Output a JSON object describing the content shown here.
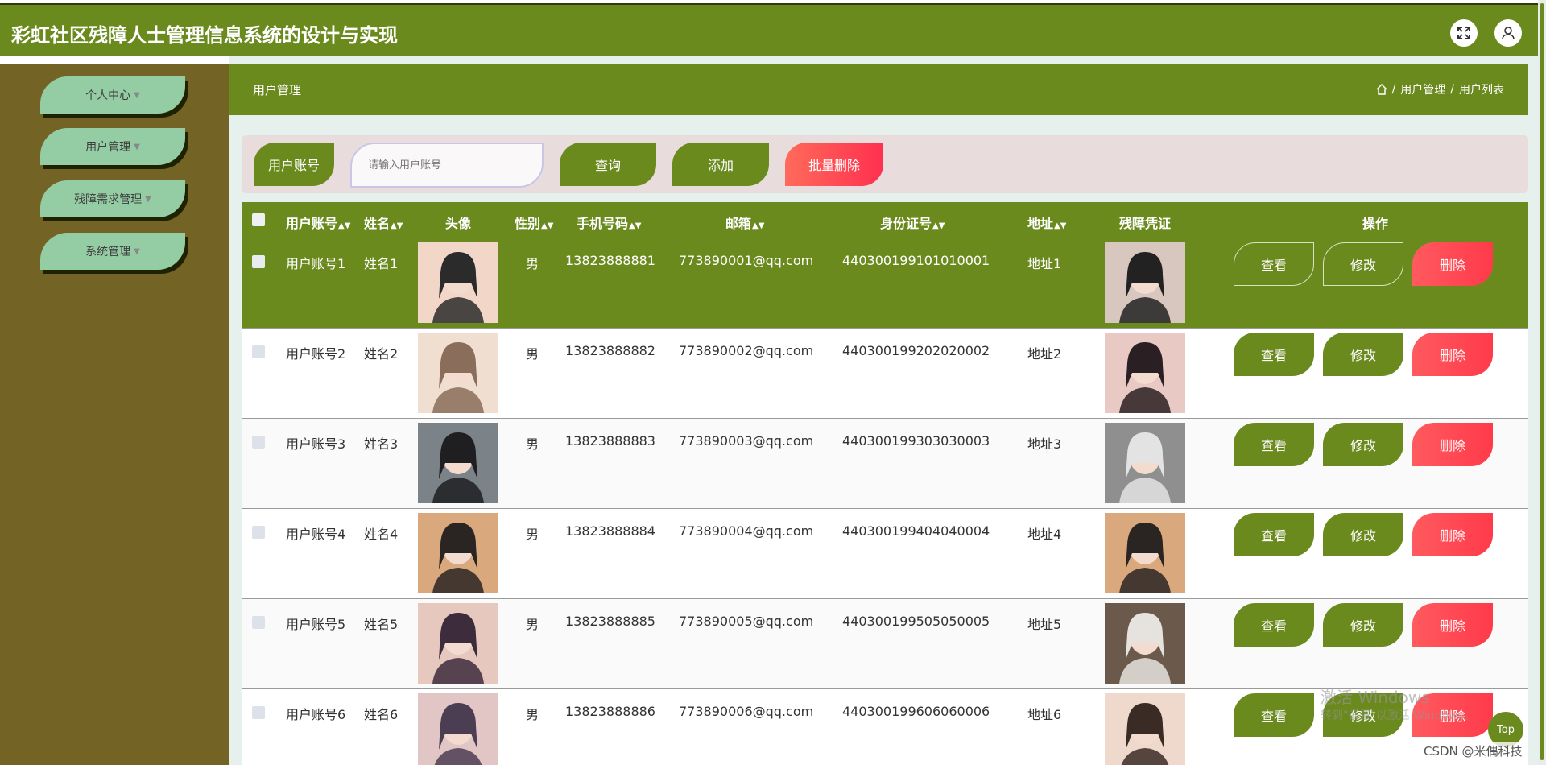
{
  "app": {
    "title": "彩虹社区残障人士管理信息系统的设计与实现"
  },
  "sidebar": {
    "items": [
      {
        "label": "个人中心"
      },
      {
        "label": "用户管理"
      },
      {
        "label": "残障需求管理"
      },
      {
        "label": "系统管理"
      }
    ]
  },
  "breadcrumb": {
    "title": "用户管理",
    "path": [
      "用户管理",
      "用户列表"
    ],
    "separator": "/"
  },
  "search": {
    "label": "用户账号",
    "placeholder": "请输入用户账号",
    "query_label": "查询",
    "add_label": "添加",
    "batch_delete_label": "批量删除"
  },
  "table": {
    "columns": [
      "用户账号",
      "姓名",
      "头像",
      "性别",
      "手机号码",
      "邮箱",
      "身份证号",
      "地址",
      "残障凭证",
      "操作"
    ],
    "rows": [
      {
        "account": "用户账号1",
        "name": "姓名1",
        "gender": "男",
        "phone": "13823888881",
        "email": "773890001@qq.com",
        "id_number": "440300199101010001",
        "address": "地址1"
      },
      {
        "account": "用户账号2",
        "name": "姓名2",
        "gender": "男",
        "phone": "13823888882",
        "email": "773890002@qq.com",
        "id_number": "440300199202020002",
        "address": "地址2"
      },
      {
        "account": "用户账号3",
        "name": "姓名3",
        "gender": "男",
        "phone": "13823888883",
        "email": "773890003@qq.com",
        "id_number": "440300199303030003",
        "address": "地址3"
      },
      {
        "account": "用户账号4",
        "name": "姓名4",
        "gender": "男",
        "phone": "13823888884",
        "email": "773890004@qq.com",
        "id_number": "440300199404040004",
        "address": "地址4"
      },
      {
        "account": "用户账号5",
        "name": "姓名5",
        "gender": "男",
        "phone": "13823888885",
        "email": "773890005@qq.com",
        "id_number": "440300199505050005",
        "address": "地址5"
      },
      {
        "account": "用户账号6",
        "name": "姓名6",
        "gender": "男",
        "phone": "13823888886",
        "email": "773890006@qq.com",
        "id_number": "440300199606060006",
        "address": "地址6"
      }
    ],
    "actions": {
      "view": "查看",
      "edit": "修改",
      "delete": "删除"
    }
  },
  "overlay": {
    "watermark_title": "激活 Windows",
    "watermark_sub": "转到\"设置\"以激活 Windows。",
    "top_label": "Top",
    "csdn": "CSDN @米偶科技"
  },
  "colors": {
    "primary": "#6b8a1e",
    "sidebar": "#736324",
    "menu": "#94cca4",
    "danger": "#ff3a4a"
  }
}
